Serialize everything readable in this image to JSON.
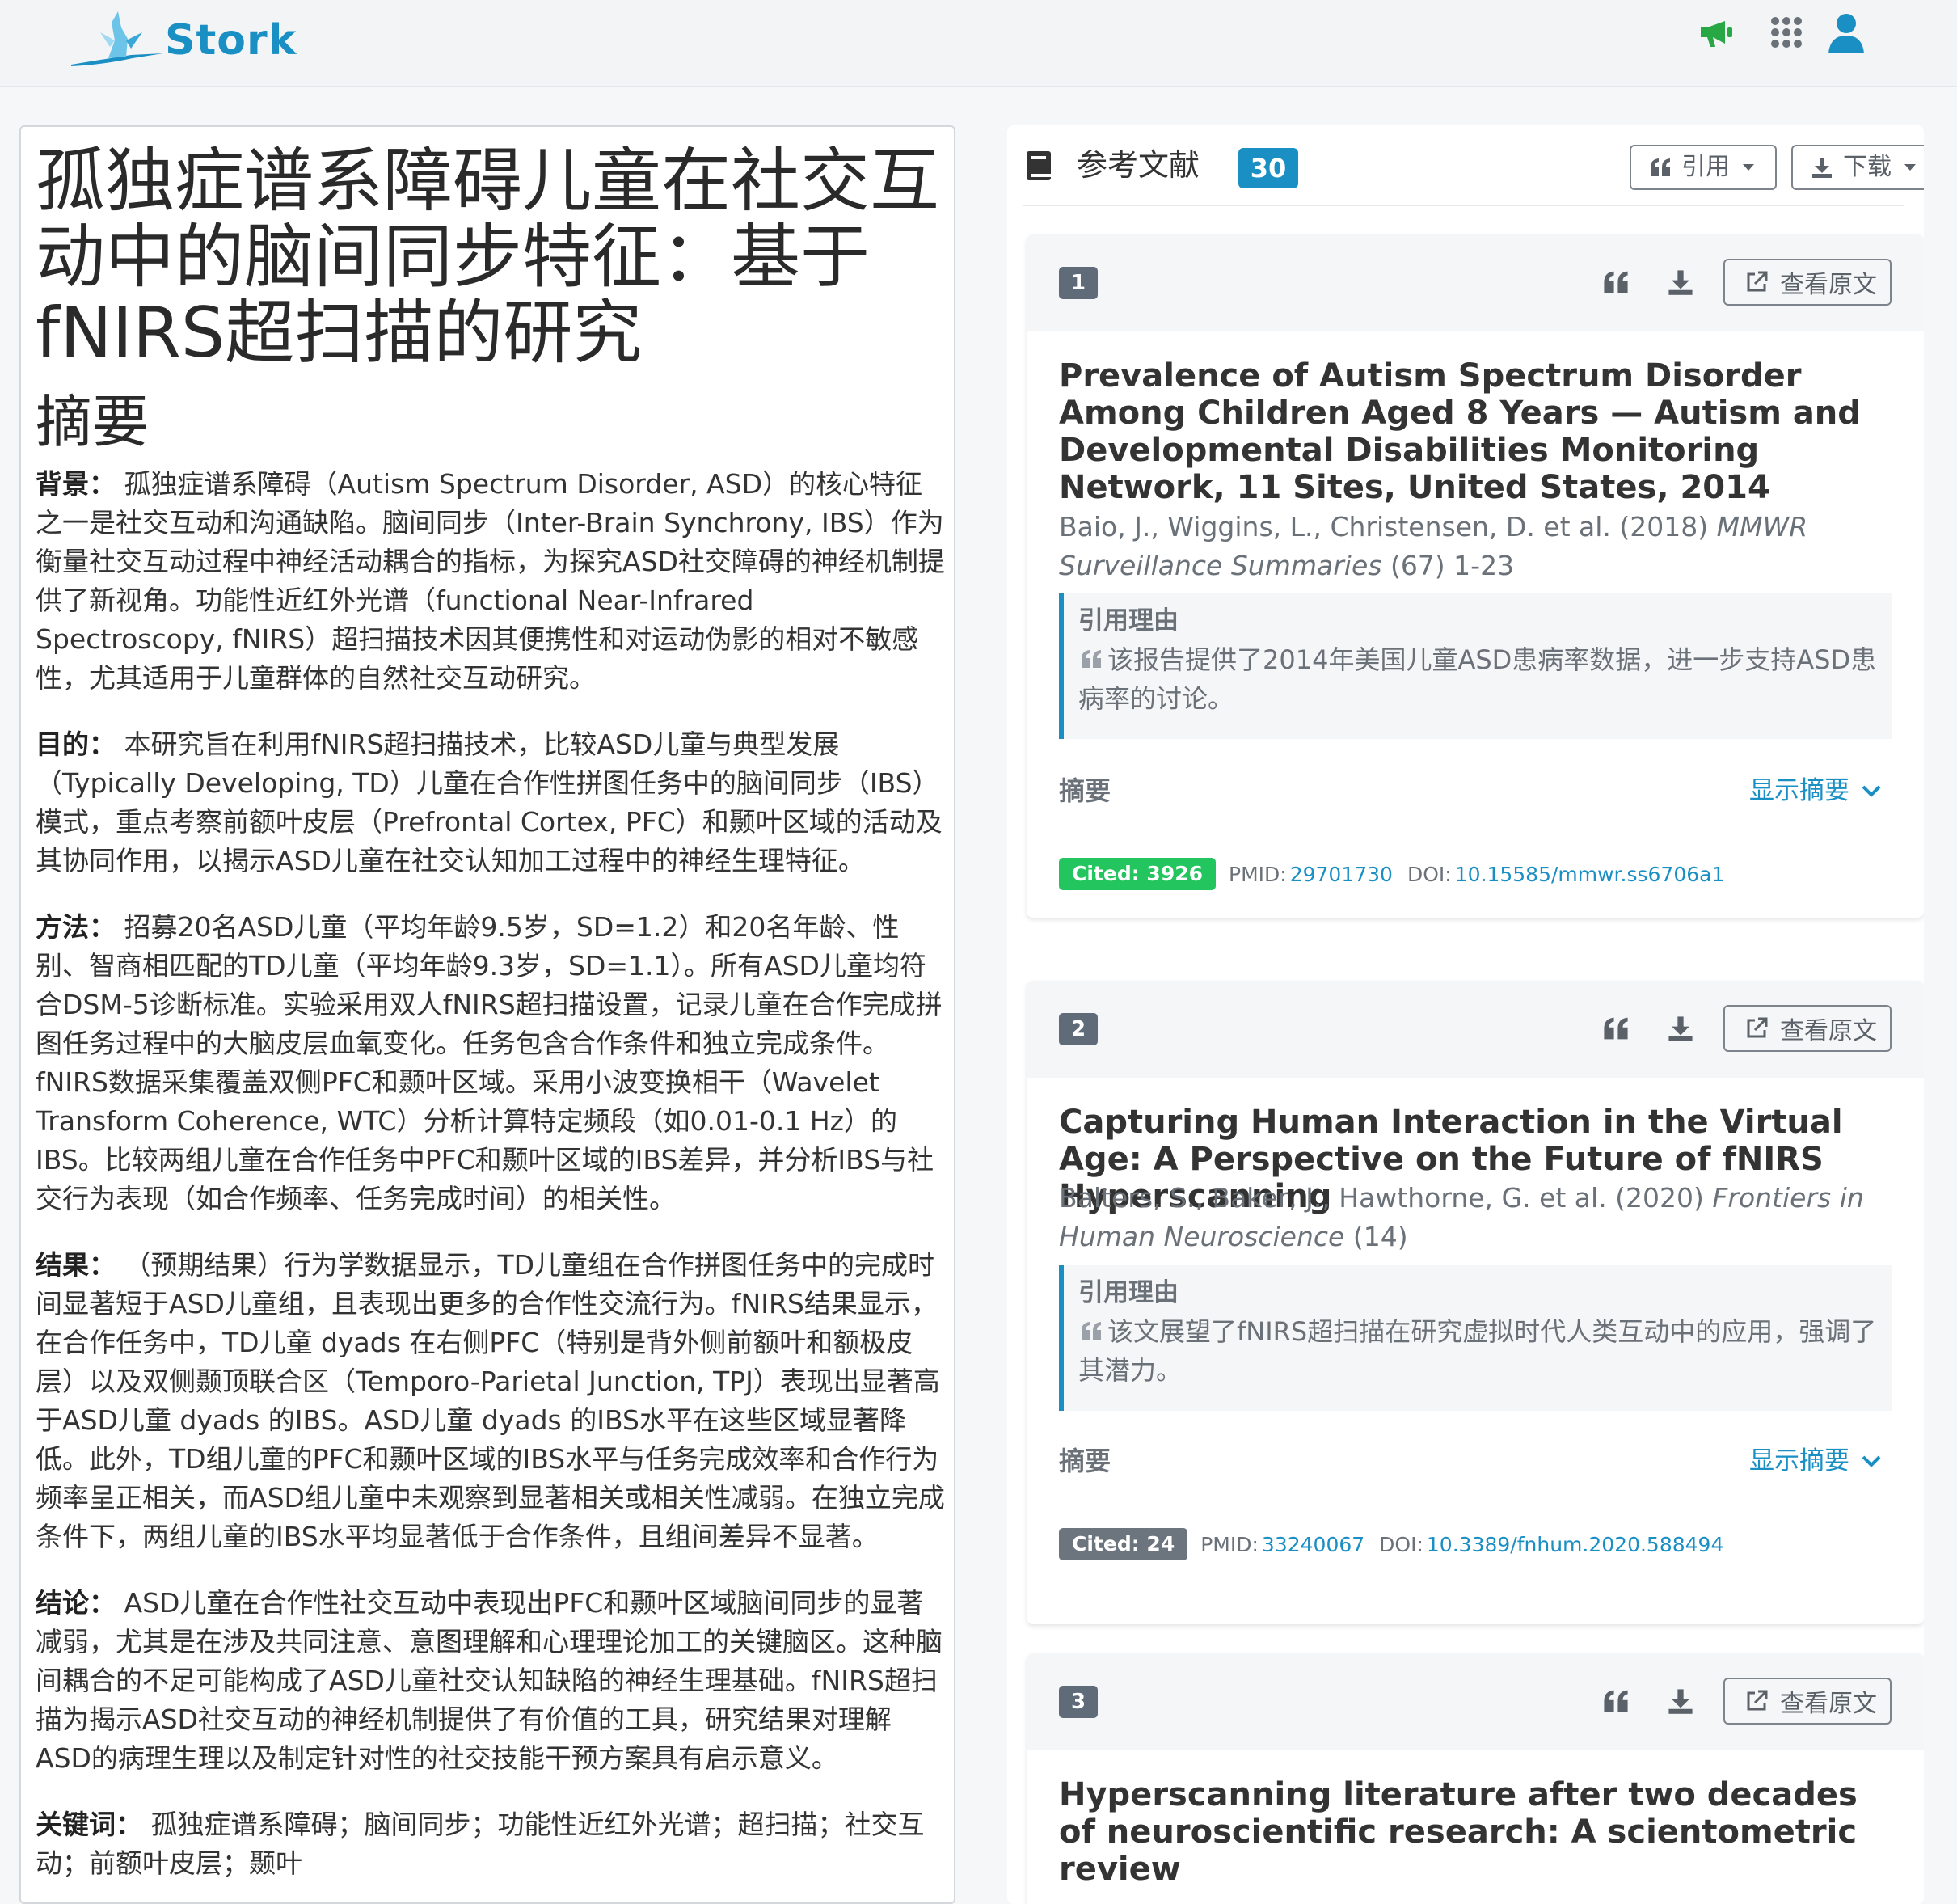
{
  "app": {
    "name": "Stork"
  },
  "colors": {
    "brand": "#1a8fc4",
    "cited_green": "#22c55e",
    "cited_gray": "#6c757d",
    "megaphone": "#28a745"
  },
  "paper": {
    "title": "孤独症谱系障碍儿童在社交互动中的脑间同步特征：基于fNIRS超扫描的研究",
    "abstract_heading": "摘要",
    "sections": [
      {
        "label": "背景：",
        "text": " 孤独症谱系障碍（Autism Spectrum Disorder, ASD）的核心特征之一是社交互动和沟通缺陷。脑间同步（Inter-Brain Synchrony, IBS）作为衡量社交互动过程中神经活动耦合的指标，为探究ASD社交障碍的神经机制提供了新视角。功能性近红外光谱（functional Near-Infrared Spectroscopy, fNIRS）超扫描技术因其便携性和对运动伪影的相对不敏感性，尤其适用于儿童群体的自然社交互动研究。"
      },
      {
        "label": "目的：",
        "text": " 本研究旨在利用fNIRS超扫描技术，比较ASD儿童与典型发展（Typically Developing, TD）儿童在合作性拼图任务中的脑间同步（IBS）模式，重点考察前额叶皮层（Prefrontal Cortex, PFC）和颞叶区域的活动及其协同作用，以揭示ASD儿童在社交认知加工过程中的神经生理特征。"
      },
      {
        "label": "方法：",
        "text": " 招募20名ASD儿童（平均年龄9.5岁，SD=1.2）和20名年龄、性别、智商相匹配的TD儿童（平均年龄9.3岁，SD=1.1）。所有ASD儿童均符合DSM-5诊断标准。实验采用双人fNIRS超扫描设置，记录儿童在合作完成拼图任务过程中的大脑皮层血氧变化。任务包含合作条件和独立完成条件。fNIRS数据采集覆盖双侧PFC和颞叶区域。采用小波变换相干（Wavelet Transform Coherence, WTC）分析计算特定频段（如0.01-0.1 Hz）的IBS。比较两组儿童在合作任务中PFC和颞叶区域的IBS差异，并分析IBS与社交行为表现（如合作频率、任务完成时间）的相关性。"
      },
      {
        "label": "结果：",
        "text": " （预期结果）行为学数据显示，TD儿童组在合作拼图任务中的完成时间显著短于ASD儿童组，且表现出更多的合作性交流行为。fNIRS结果显示，在合作任务中，TD儿童 dyads 在右侧PFC（特别是背外侧前额叶和额极皮层）以及双侧颞顶联合区（Temporo-Parietal Junction, TPJ）表现出显著高于ASD儿童 dyads 的IBS。ASD儿童 dyads 的IBS水平在这些区域显著降低。此外，TD组儿童的PFC和颞叶区域的IBS水平与任务完成效率和合作行为频率呈正相关，而ASD组儿童中未观察到显著相关或相关性减弱。在独立完成条件下，两组儿童的IBS水平均显著低于合作条件，且组间差异不显著。"
      },
      {
        "label": "结论：",
        "text": " ASD儿童在合作性社交互动中表现出PFC和颞叶区域脑间同步的显著减弱，尤其是在涉及共同注意、意图理解和心理理论加工的关键脑区。这种脑间耦合的不足可能构成了ASD儿童社交认知缺陷的神经生理基础。fNIRS超扫描为揭示ASD社交互动的神经机制提供了有价值的工具，研究结果对理解ASD的病理生理以及制定针对性的社交技能干预方案具有启示意义。"
      },
      {
        "label": "关键词：",
        "text": " 孤独症谱系障碍；脑间同步；功能性近红外光谱；超扫描；社交互动；前额叶皮层；颞叶"
      }
    ]
  },
  "refs": {
    "heading": "参考文献",
    "count": "30",
    "cite_btn": "引用",
    "download_btn": "下载",
    "view_label": "查看原文",
    "reason_heading": "引用理由",
    "abstract_label": "摘要",
    "show_abstract": "显示摘要",
    "pmid_label": "PMID:",
    "doi_label": "DOI:",
    "items": [
      {
        "num": "1",
        "title": "Prevalence of Autism Spectrum Disorder Among Children Aged 8 Years — Autism and Developmental Disabilities Monitoring Network, 11 Sites, United States, 2014",
        "authors": "Baio, J., Wiggins, L., Christensen, D. et al. (2018) ",
        "journal": "MMWR Surveillance Summaries",
        "tail": " (67) 1-23",
        "reason": "该报告提供了2014年美国儿童ASD患病率数据，进一步支持ASD患病率的讨论。",
        "cited": "Cited: 3926",
        "pmid": "29701730",
        "doi": "10.15585/mmwr.ss6706a1"
      },
      {
        "num": "2",
        "title": "Capturing Human Interaction in the Virtual Age: A Perspective on the Future of fNIRS Hyperscanning",
        "authors": "Balters, S., Baker, J., Hawthorne, G. et al. (2020) ",
        "journal": "Frontiers in Human Neuroscience",
        "tail": " (14)",
        "reason": "该文展望了fNIRS超扫描在研究虚拟时代人类互动中的应用，强调了其潜力。",
        "cited": "Cited: 24",
        "pmid": "33240067",
        "doi": "10.3389/fnhum.2020.588494"
      },
      {
        "num": "3",
        "title": "Hyperscanning literature after two decades of neuroscientific research: A scientometric review"
      }
    ]
  }
}
